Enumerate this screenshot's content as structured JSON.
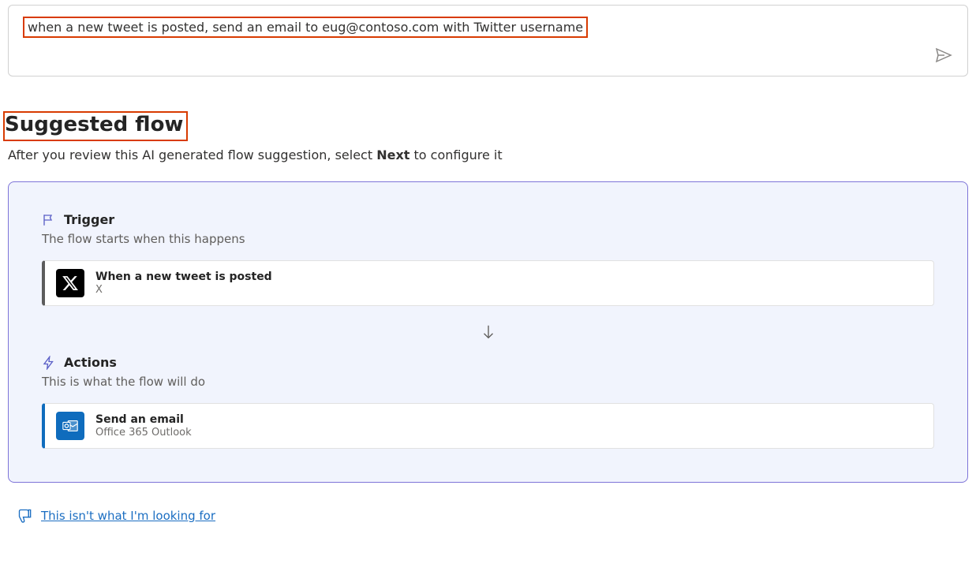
{
  "prompt": {
    "text": "when a new tweet is posted, send an email to eug@contoso.com with Twitter username"
  },
  "suggested": {
    "title": "Suggested flow",
    "desc_before": "After you review this AI generated flow suggestion, select ",
    "desc_bold": "Next",
    "desc_after": " to configure it"
  },
  "trigger": {
    "heading": "Trigger",
    "sub": "The flow starts when this happens",
    "step_title": "When a new tweet is posted",
    "step_sub": "X"
  },
  "actions": {
    "heading": "Actions",
    "sub": "This is what the flow will do",
    "step_title": "Send an email",
    "step_sub": "Office 365 Outlook"
  },
  "feedback": {
    "link": "This isn't what I'm looking for"
  }
}
